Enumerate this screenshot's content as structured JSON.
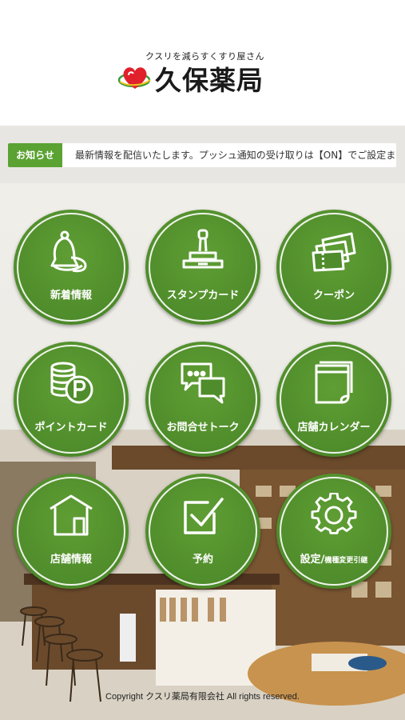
{
  "header": {
    "tagline": "クスリを減らすくすり屋さん",
    "logo_text": "久保薬局",
    "logo_icon": "heart-globe-icon"
  },
  "news": {
    "tag": "お知らせ",
    "text": "最新情報を配信いたします。プッシュ通知の受け取りは【ON】でご設定ま"
  },
  "tiles": [
    {
      "label": "新着情報",
      "icon": "bell-icon"
    },
    {
      "label": "スタンプカード",
      "icon": "stamp-icon"
    },
    {
      "label": "クーポン",
      "icon": "coupon-icon"
    },
    {
      "label": "ポイントカード",
      "icon": "coin-point-icon"
    },
    {
      "label": "お問合せトーク",
      "icon": "chat-bubbles-icon"
    },
    {
      "label": "店舗カレンダー",
      "icon": "calendar-icon"
    },
    {
      "label": "店舗情報",
      "icon": "store-house-icon"
    },
    {
      "label": "予約",
      "icon": "checkbox-icon"
    },
    {
      "label": "設定/",
      "label_small": "機種変更引継",
      "icon": "gear-icon"
    }
  ],
  "footer": {
    "copyright": "Copyright クスリ薬局有限会社 All rights reserved."
  },
  "colors": {
    "tile_green": "#4f8c2b",
    "news_tag_green": "#5aa232",
    "logo_red": "#e0202a"
  }
}
